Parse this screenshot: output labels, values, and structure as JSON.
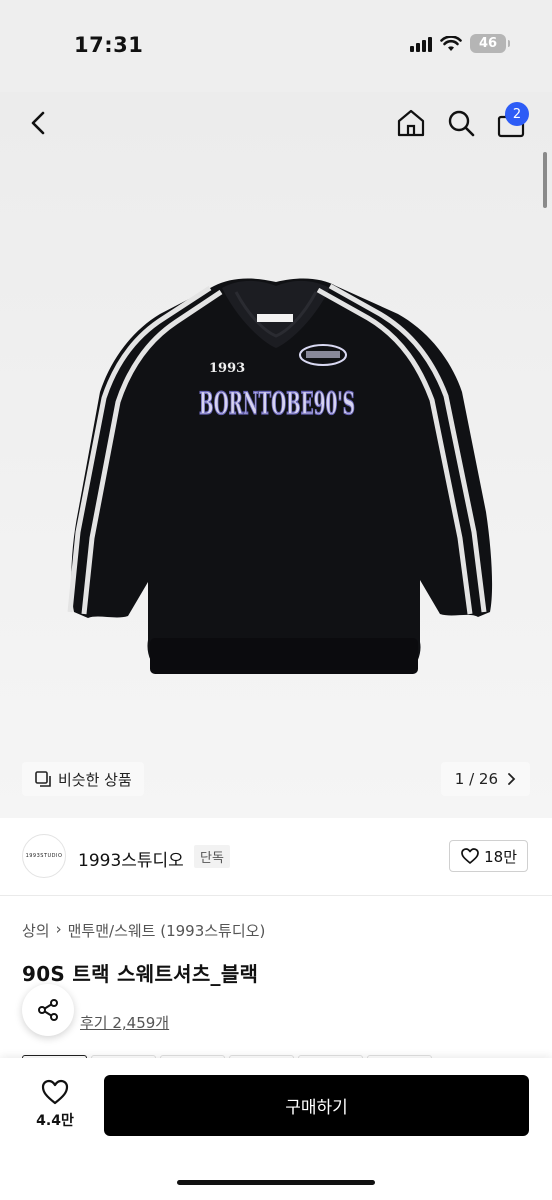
{
  "status_bar": {
    "time": "17:31",
    "battery": "46"
  },
  "header": {
    "cart_count": "2"
  },
  "image": {
    "similar_label": "비슷한 상품",
    "page_indicator": "1 / 26",
    "graphic_text": {
      "print": "BORNTOBE90'S",
      "chest_logo": "1993"
    }
  },
  "brand": {
    "logo_text": "1993STUDIO",
    "name": "1993스튜디오",
    "tag": "단독",
    "likes": "18만"
  },
  "product": {
    "breadcrumb": [
      "상의",
      "맨투맨/스웨트 (1993스튜디오)"
    ],
    "title": "90S 트랙 스웨트셔츠_블랙",
    "reviews": "후기 2,459개"
  },
  "bottom_bar": {
    "wish_count": "4.4만",
    "buy_label": "구매하기"
  }
}
